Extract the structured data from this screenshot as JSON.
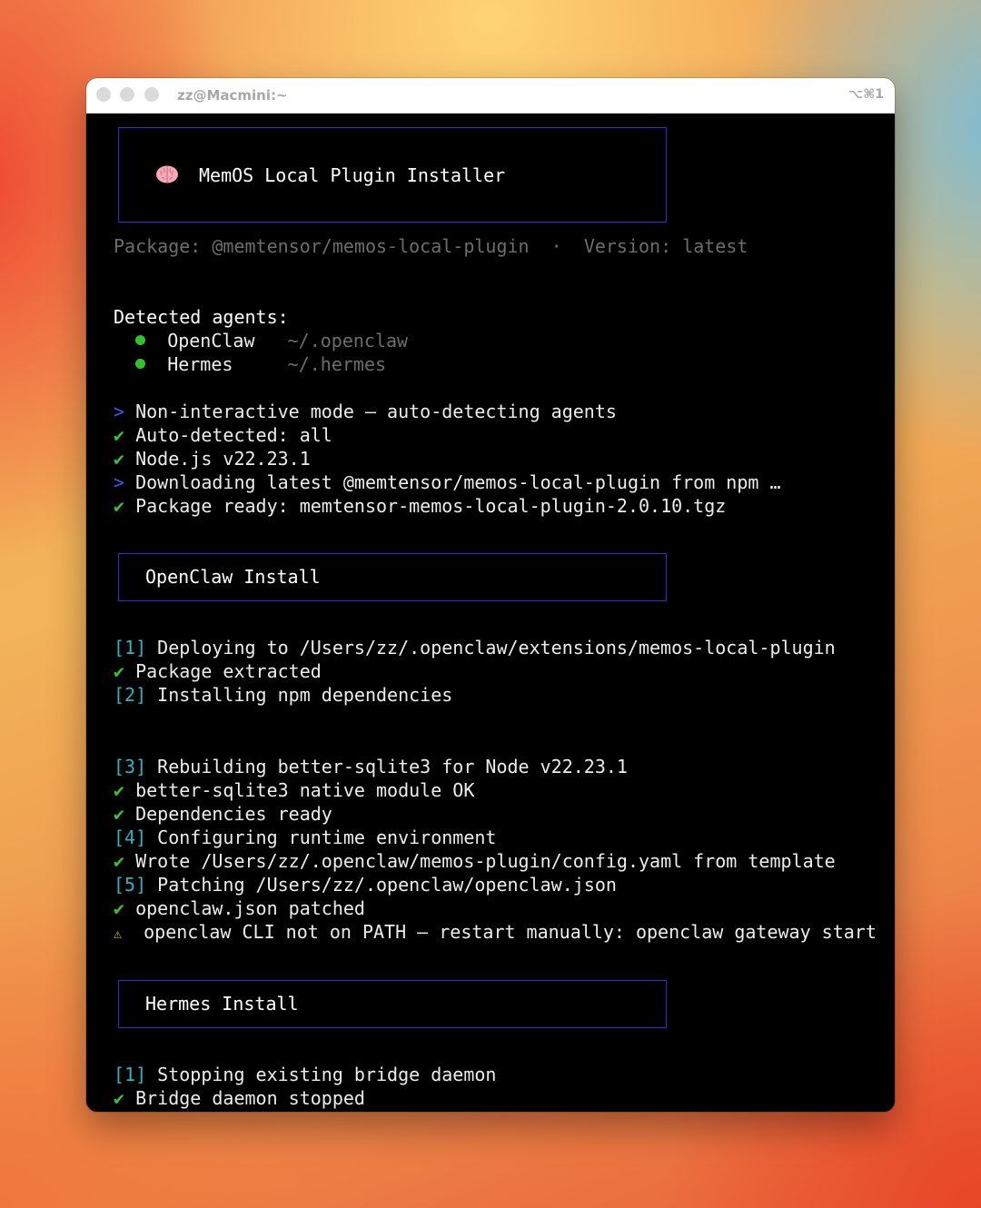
{
  "window": {
    "title": "zz@Macmini:~",
    "shortcut": "⌥⌘1"
  },
  "header_box": {
    "title": "MemOS Local Plugin Installer"
  },
  "package_line": {
    "package_label": "Package:",
    "package_value": "@memtensor/memos-local-plugin",
    "separator": "·",
    "version_label": "Version:",
    "version_value": "latest"
  },
  "agents": {
    "heading": "Detected agents:",
    "items": [
      {
        "name": "OpenClaw",
        "path": "~/.openclaw"
      },
      {
        "name": "Hermes",
        "path": "~/.hermes"
      }
    ]
  },
  "prelude_lines": [
    {
      "marker": ">",
      "text": "Non-interactive mode — auto-detecting agents"
    },
    {
      "marker": "✔",
      "text": "Auto-detected: all"
    },
    {
      "marker": "✔",
      "text": "Node.js v22.23.1"
    },
    {
      "marker": ">",
      "text": "Downloading latest @memtensor/memos-local-plugin from npm …"
    },
    {
      "marker": "✔",
      "text": "Package ready: memtensor-memos-local-plugin-2.0.10.tgz"
    }
  ],
  "openclaw_section": {
    "title": "OpenClaw Install",
    "lines": [
      {
        "marker": "[1]",
        "text": "Deploying to /Users/zz/.openclaw/extensions/memos-local-plugin"
      },
      {
        "marker": "✔",
        "text": "Package extracted"
      },
      {
        "marker": "[2]",
        "text": "Installing npm dependencies"
      },
      {
        "marker": "[3]",
        "text": "Rebuilding better-sqlite3 for Node v22.23.1"
      },
      {
        "marker": "✔",
        "text": "better-sqlite3 native module OK"
      },
      {
        "marker": "✔",
        "text": "Dependencies ready"
      },
      {
        "marker": "[4]",
        "text": "Configuring runtime environment"
      },
      {
        "marker": "✔",
        "text": "Wrote /Users/zz/.openclaw/memos-plugin/config.yaml from template"
      },
      {
        "marker": "[5]",
        "text": "Patching /Users/zz/.openclaw/openclaw.json"
      },
      {
        "marker": "✔",
        "text": "openclaw.json patched"
      },
      {
        "marker": "⚠",
        "text": "openclaw CLI not on PATH — restart manually: openclaw gateway start"
      }
    ]
  },
  "hermes_section": {
    "title": "Hermes Install",
    "lines": [
      {
        "marker": "[1]",
        "text": "Stopping existing bridge daemon"
      },
      {
        "marker": "✔",
        "text": "Bridge daemon stopped"
      }
    ]
  },
  "icons": {
    "header": "brain-icon",
    "agent_status": "green-dot-icon",
    "info": "chevron-right-icon",
    "success": "check-icon",
    "warning": "warning-icon"
  },
  "colors": {
    "success": "#38c430",
    "info": "#3a5cf0",
    "step": "#2bb5c4",
    "warning": "#d8c635",
    "box_border": "#2a2fd6",
    "dim_text": "#6d6d6d"
  }
}
